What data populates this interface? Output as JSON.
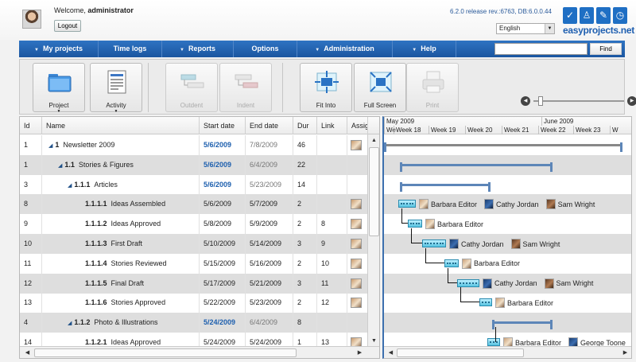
{
  "header": {
    "welcome_prefix": "Welcome,",
    "username": "administrator",
    "logout_label": "Logout",
    "release": "6.2.0 release rev.:6763, DB:6.0.0.44",
    "language": "English",
    "logo_text": "easyprojects.net",
    "logo_icons": [
      "check-icon",
      "user-icon",
      "puzzle-icon",
      "clock-icon"
    ]
  },
  "nav": {
    "items": [
      {
        "label": "My projects",
        "chevron": true
      },
      {
        "label": "Time logs",
        "chevron": false
      },
      {
        "label": "Reports",
        "chevron": true
      },
      {
        "label": "Options",
        "chevron": false
      },
      {
        "label": "Administration",
        "chevron": true
      },
      {
        "label": "Help",
        "chevron": true
      }
    ],
    "search_placeholder": "",
    "find_label": "Find"
  },
  "toolbar": {
    "project_label": "Project",
    "activity_label": "Activity",
    "outdent_label": "Outdent",
    "indent_label": "Indent",
    "fit_into_label": "Fit Into",
    "full_screen_label": "Full Screen",
    "print_label": "Print",
    "zoom_level": 0.05
  },
  "grid": {
    "columns": [
      "Id",
      "Name",
      "Start date",
      "End date",
      "Dur",
      "Link",
      "Assig"
    ],
    "rows": [
      {
        "id": "1",
        "level": 0,
        "wbs": "1",
        "name": "Newsletter 2009",
        "start": "5/6/2009",
        "end": "7/8/2009",
        "dur": "46",
        "link": "",
        "summary": true,
        "shaded": false,
        "assign": true
      },
      {
        "id": "1",
        "level": 1,
        "wbs": "1.1",
        "name": "Stories & Figures",
        "start": "5/6/2009",
        "end": "6/4/2009",
        "dur": "22",
        "link": "",
        "summary": true,
        "shaded": true,
        "assign": false
      },
      {
        "id": "3",
        "level": 2,
        "wbs": "1.1.1",
        "name": "Articles",
        "start": "5/6/2009",
        "end": "5/23/2009",
        "dur": "14",
        "link": "",
        "summary": true,
        "shaded": false,
        "assign": false
      },
      {
        "id": "8",
        "level": 3,
        "wbs": "1.1.1.1",
        "name": "Ideas Assembled",
        "start": "5/6/2009",
        "end": "5/7/2009",
        "dur": "2",
        "link": "",
        "summary": false,
        "shaded": true,
        "assign": true
      },
      {
        "id": "9",
        "level": 3,
        "wbs": "1.1.1.2",
        "name": "Ideas Approved",
        "start": "5/8/2009",
        "end": "5/9/2009",
        "dur": "2",
        "link": "8",
        "summary": false,
        "shaded": false,
        "assign": true
      },
      {
        "id": "10",
        "level": 3,
        "wbs": "1.1.1.3",
        "name": "First Draft",
        "start": "5/10/2009",
        "end": "5/14/2009",
        "dur": "3",
        "link": "9",
        "summary": false,
        "shaded": true,
        "assign": true
      },
      {
        "id": "11",
        "level": 3,
        "wbs": "1.1.1.4",
        "name": "Stories Reviewed",
        "start": "5/15/2009",
        "end": "5/16/2009",
        "dur": "2",
        "link": "10",
        "summary": false,
        "shaded": false,
        "assign": true
      },
      {
        "id": "12",
        "level": 3,
        "wbs": "1.1.1.5",
        "name": "Final Draft",
        "start": "5/17/2009",
        "end": "5/21/2009",
        "dur": "3",
        "link": "11",
        "summary": false,
        "shaded": true,
        "assign": true
      },
      {
        "id": "13",
        "level": 3,
        "wbs": "1.1.1.6",
        "name": "Stories Approved",
        "start": "5/22/2009",
        "end": "5/23/2009",
        "dur": "2",
        "link": "12",
        "summary": false,
        "shaded": false,
        "assign": true
      },
      {
        "id": "4",
        "level": 2,
        "wbs": "1.1.2",
        "name": "Photo & Illustrations",
        "start": "5/24/2009",
        "end": "6/4/2009",
        "dur": "8",
        "link": "",
        "summary": true,
        "shaded": true,
        "assign": false
      },
      {
        "id": "14",
        "level": 3,
        "wbs": "1.1.2.1",
        "name": "Ideas Approved",
        "start": "5/24/2009",
        "end": "5/24/2009",
        "dur": "1",
        "link": "13",
        "summary": false,
        "shaded": false,
        "assign": true
      }
    ]
  },
  "gantt": {
    "months": [
      "May 2009",
      "June 2009"
    ],
    "weeks": [
      "We",
      "Week 18",
      "Week 19",
      "Week 20",
      "Week 21",
      "Week 22",
      "Week 23",
      "W"
    ],
    "rows": [
      {
        "type": "project"
      },
      {
        "type": "summary"
      },
      {
        "type": "summary"
      },
      {
        "type": "task",
        "resources": [
          {
            "name": "Barbara Editor",
            "photo": "light"
          },
          {
            "name": "Cathy Jordan",
            "photo": "dark"
          },
          {
            "name": "Sam Wright",
            "photo": "brown"
          }
        ]
      },
      {
        "type": "task",
        "resources": [
          {
            "name": "Barbara Editor",
            "photo": "light"
          }
        ]
      },
      {
        "type": "task",
        "resources": [
          {
            "name": "Cathy Jordan",
            "photo": "dark"
          },
          {
            "name": "Sam Wright",
            "photo": "brown"
          }
        ]
      },
      {
        "type": "task",
        "resources": [
          {
            "name": "Barbara Editor",
            "photo": "light"
          }
        ]
      },
      {
        "type": "task",
        "resources": [
          {
            "name": "Cathy Jordan",
            "photo": "dark"
          },
          {
            "name": "Sam Wright",
            "photo": "brown"
          }
        ]
      },
      {
        "type": "task",
        "resources": [
          {
            "name": "Barbara Editor",
            "photo": "light"
          }
        ]
      },
      {
        "type": "summary"
      },
      {
        "type": "task",
        "resources": [
          {
            "name": "Barbara Editor",
            "photo": "light"
          },
          {
            "name": "George Toone",
            "photo": "dark"
          }
        ]
      }
    ]
  },
  "colors": {
    "nav": "#1f5fae",
    "accent": "#1d5fae",
    "row_shade": "#dedede",
    "bar": "#55c3e0"
  }
}
